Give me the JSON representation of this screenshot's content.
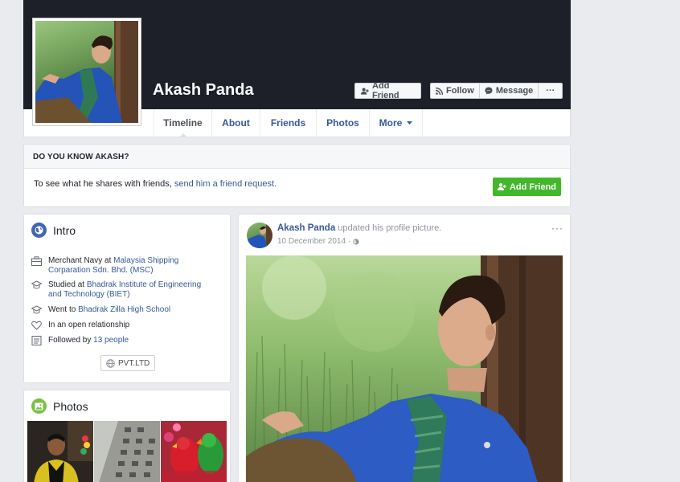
{
  "profile": {
    "name": "Akash Panda",
    "add_friend_label": "Add Friend",
    "follow_label": "Follow",
    "message_label": "Message",
    "more_dots": "···"
  },
  "tabs": [
    {
      "label": "Timeline"
    },
    {
      "label": "About"
    },
    {
      "label": "Friends"
    },
    {
      "label": "Photos"
    },
    {
      "label": "More"
    }
  ],
  "do_you_know": {
    "heading": "DO YOU KNOW AKASH?",
    "text": "To see what he shares with friends, ",
    "link": "send him a friend request.",
    "button": "Add Friend"
  },
  "intro": {
    "title": "Intro",
    "rows": [
      {
        "prefix": "Merchant Navy at ",
        "link": "Malaysia Shipping Corparation Sdn. Bhd. (MSC)"
      },
      {
        "prefix": "Studied at ",
        "link": "Bhadrak Institute of Engineering and Technology (BIET)"
      },
      {
        "prefix": "Went to ",
        "link": "Bhadrak Zilla High School"
      },
      {
        "prefix": "In an open relationship",
        "link": ""
      },
      {
        "prefix": "Followed by ",
        "link": "13 people"
      }
    ],
    "badge": "PVT.LTD"
  },
  "photos": {
    "title": "Photos"
  },
  "post": {
    "author": "Akash Panda",
    "action": " updated his profile picture.",
    "date": "10 December 2014 ·",
    "more": "···"
  },
  "colors": {
    "cover": "#1d2029",
    "link": "#365899",
    "green_button": "#42b72a",
    "background": "#e9ebee"
  }
}
